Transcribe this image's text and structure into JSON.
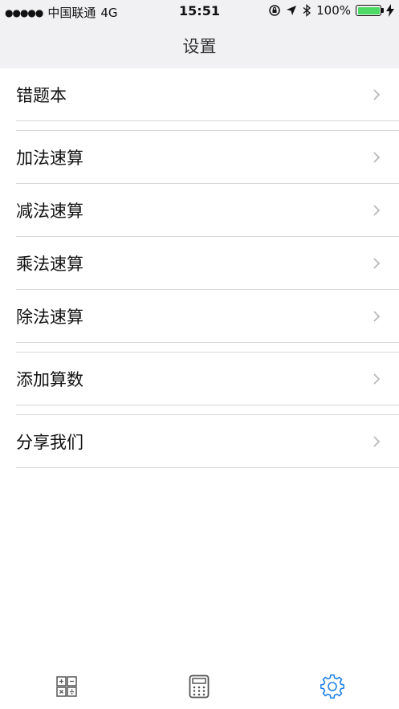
{
  "status": {
    "carrier": "中国联通",
    "network": "4G",
    "time": "15:51",
    "battery_percent": "100%"
  },
  "nav": {
    "title": "设置"
  },
  "menu": {
    "items": [
      {
        "label": "错题本"
      },
      {
        "label": "加法速算"
      },
      {
        "label": "减法速算"
      },
      {
        "label": "乘法速算"
      },
      {
        "label": "除法速算"
      },
      {
        "label": "添加算数"
      },
      {
        "label": "分享我们"
      }
    ]
  },
  "tabs": [
    {
      "icon": "grid-operators-icon",
      "active": false
    },
    {
      "icon": "calculator-icon",
      "active": false
    },
    {
      "icon": "gear-icon",
      "active": true
    }
  ],
  "colors": {
    "accent": "#1f7fe6",
    "battery": "#4cd964",
    "nav_bg": "#f1f1f4"
  }
}
